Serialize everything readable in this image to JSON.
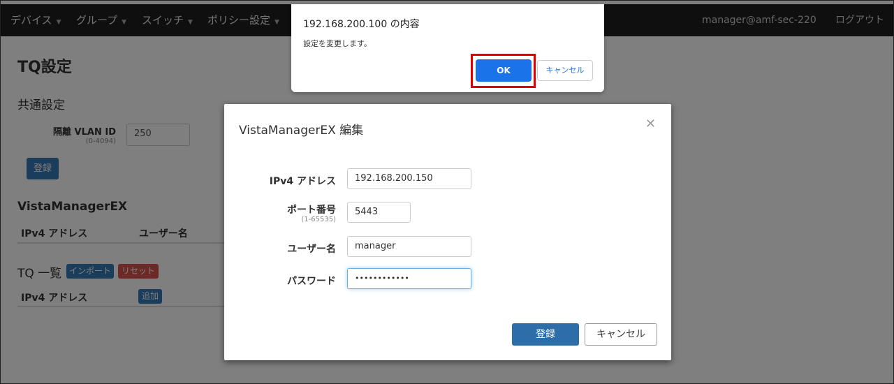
{
  "navbar": {
    "items": [
      {
        "label": "デバイス"
      },
      {
        "label": "グループ"
      },
      {
        "label": "スイッチ"
      },
      {
        "label": "ポリシー設定"
      }
    ],
    "user": "manager@amf-sec-220",
    "logout_label": "ログアウト"
  },
  "page": {
    "title": "TQ設定",
    "common_section": "共通設定",
    "vlan_label": "隔離 VLAN ID",
    "vlan_range": "(0-4094)",
    "vlan_value": "250",
    "register_label": "登録",
    "vista_section": "VistaManagerEX",
    "vista_columns": [
      "IPv4 アドレス",
      "ユーザー名"
    ],
    "tq_section": "TQ 一覧",
    "import_label": "インポート",
    "reset_label": "リセット",
    "tq_columns": [
      "IPv4 アドレス"
    ],
    "add_label": "追加"
  },
  "modal": {
    "title": "VistaManagerEX 編集",
    "ipv4_label": "IPv4 アドレス",
    "ipv4_value": "192.168.200.150",
    "port_label": "ポート番号",
    "port_range": "(1-65535)",
    "port_value": "5443",
    "user_label": "ユーザー名",
    "user_value": "manager",
    "password_label": "パスワード",
    "password_value": "••••••••••••",
    "register_label": "登録",
    "cancel_label": "キャンセル"
  },
  "dialog": {
    "title": "192.168.200.100 の内容",
    "message": "設定を変更します。",
    "ok_label": "OK",
    "cancel_label": "キャンセル"
  },
  "colors": {
    "navbar": "#1f1f1f",
    "primary": "#337ab7",
    "danger": "#d9534f",
    "dialog_ok": "#1a73e8",
    "highlight": "#e00000"
  }
}
